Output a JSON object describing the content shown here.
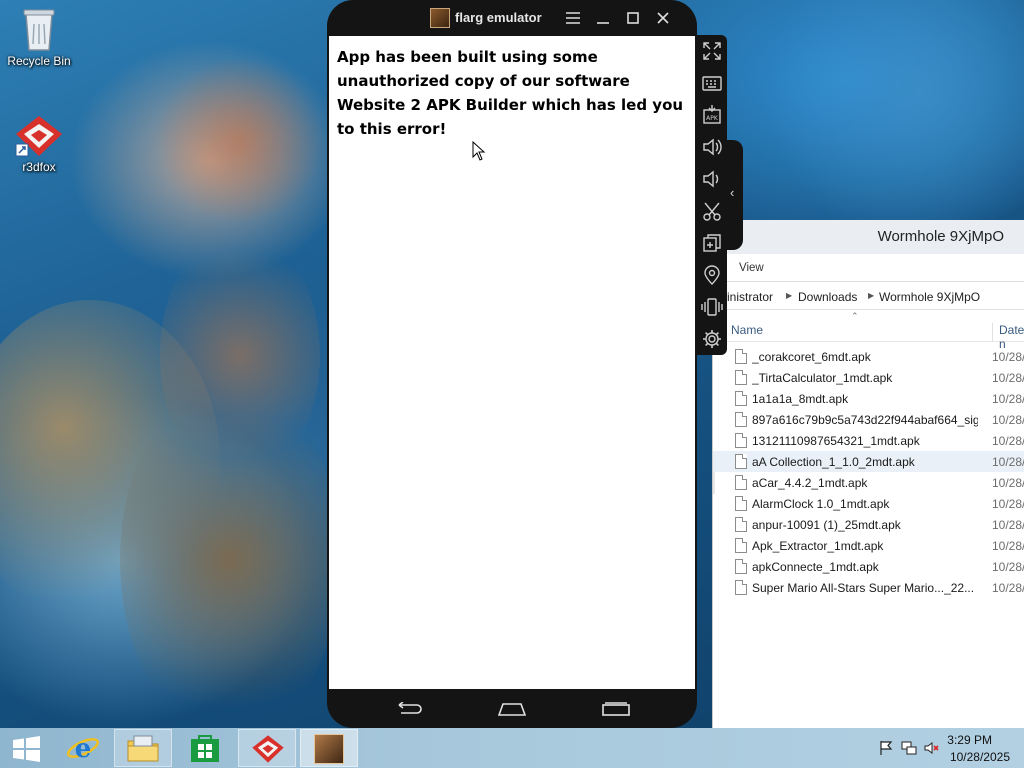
{
  "desktop": {
    "icons": [
      {
        "label": "Recycle Bin"
      },
      {
        "label": "r3dfox"
      }
    ]
  },
  "emulator": {
    "title": "flarg emulator",
    "controls": [
      "menu-icon",
      "minimize-icon",
      "maximize-icon",
      "close-icon"
    ],
    "error_message": "App has been built using some unauthorized copy of our software Website 2 APK Builder which has led you to this error!",
    "toolbar": [
      "fullscreen-icon",
      "keyboard-icon",
      "install-apk-icon",
      "volume-up-icon",
      "volume-down-icon",
      "screenshot-scissors-icon",
      "multi-instance-icon",
      "location-icon",
      "shake-icon",
      "settings-icon"
    ],
    "navbar": [
      "back-icon",
      "home-icon",
      "recent-apps-icon"
    ]
  },
  "explorer": {
    "title": "Wormhole 9XjMpO",
    "ribbon_tab": "View",
    "breadcrumb": [
      "inistrator",
      "Downloads",
      "Wormhole 9XjMpO"
    ],
    "columns": {
      "name": "Name",
      "date": "Date n"
    },
    "files": [
      {
        "name": "_corakcoret_6mdt.apk",
        "date": "10/28/"
      },
      {
        "name": "_TirtaCalculator_1mdt.apk",
        "date": "10/28/"
      },
      {
        "name": "1a1a1a_8mdt.apk",
        "date": "10/28/"
      },
      {
        "name": "897a616c79b9c5a743d22f944abaf664_sig...",
        "date": "10/28/"
      },
      {
        "name": "13121110987654321_1mdt.apk",
        "date": "10/28/"
      },
      {
        "name": "aA Collection_1_1.0_2mdt.apk",
        "date": "10/28/"
      },
      {
        "name": "aCar_4.4.2_1mdt.apk",
        "date": "10/28/"
      },
      {
        "name": "AlarmClock 1.0_1mdt.apk",
        "date": "10/28/"
      },
      {
        "name": "anpur-10091 (1)_25mdt.apk",
        "date": "10/28/"
      },
      {
        "name": "Apk_Extractor_1mdt.apk",
        "date": "10/28/"
      },
      {
        "name": "apkConnecte_1mdt.apk",
        "date": "10/28/"
      },
      {
        "name": "Super Mario All-Stars  Super Mario..._22...",
        "date": "10/28/"
      }
    ]
  },
  "taskbar": {
    "items": [
      "start-button",
      "internet-explorer-icon",
      "file-explorer-icon",
      "store-icon",
      "r3dfox-icon",
      "flarg-emulator-icon"
    ],
    "clock": {
      "time": "3:29 PM",
      "date": "10/28/2025"
    }
  },
  "colors": {
    "emulator_frame": "#141414",
    "taskbar": "#a6c7db",
    "explorer_header": "#3a5b80"
  }
}
